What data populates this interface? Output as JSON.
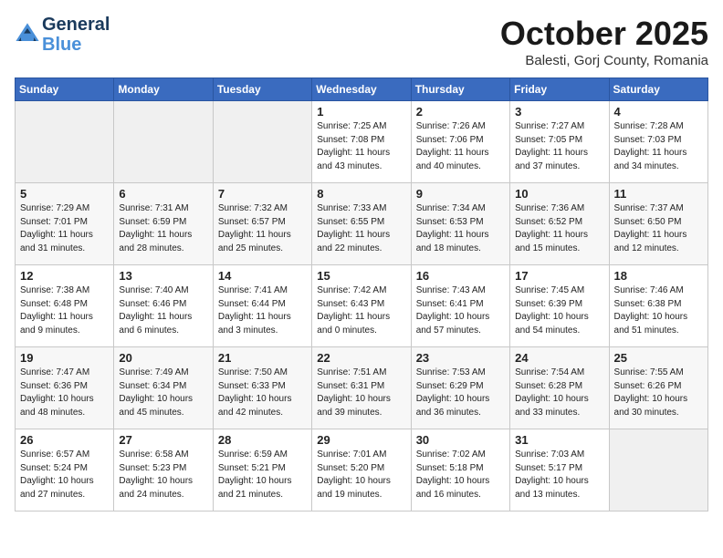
{
  "header": {
    "logo_line1": "General",
    "logo_line2": "Blue",
    "month": "October 2025",
    "location": "Balesti, Gorj County, Romania"
  },
  "weekdays": [
    "Sunday",
    "Monday",
    "Tuesday",
    "Wednesday",
    "Thursday",
    "Friday",
    "Saturday"
  ],
  "weeks": [
    [
      {
        "day": "",
        "info": "",
        "empty": true
      },
      {
        "day": "",
        "info": "",
        "empty": true
      },
      {
        "day": "",
        "info": "",
        "empty": true
      },
      {
        "day": "1",
        "info": "Sunrise: 7:25 AM\nSunset: 7:08 PM\nDaylight: 11 hours\nand 43 minutes."
      },
      {
        "day": "2",
        "info": "Sunrise: 7:26 AM\nSunset: 7:06 PM\nDaylight: 11 hours\nand 40 minutes."
      },
      {
        "day": "3",
        "info": "Sunrise: 7:27 AM\nSunset: 7:05 PM\nDaylight: 11 hours\nand 37 minutes."
      },
      {
        "day": "4",
        "info": "Sunrise: 7:28 AM\nSunset: 7:03 PM\nDaylight: 11 hours\nand 34 minutes."
      }
    ],
    [
      {
        "day": "5",
        "info": "Sunrise: 7:29 AM\nSunset: 7:01 PM\nDaylight: 11 hours\nand 31 minutes."
      },
      {
        "day": "6",
        "info": "Sunrise: 7:31 AM\nSunset: 6:59 PM\nDaylight: 11 hours\nand 28 minutes."
      },
      {
        "day": "7",
        "info": "Sunrise: 7:32 AM\nSunset: 6:57 PM\nDaylight: 11 hours\nand 25 minutes."
      },
      {
        "day": "8",
        "info": "Sunrise: 7:33 AM\nSunset: 6:55 PM\nDaylight: 11 hours\nand 22 minutes."
      },
      {
        "day": "9",
        "info": "Sunrise: 7:34 AM\nSunset: 6:53 PM\nDaylight: 11 hours\nand 18 minutes."
      },
      {
        "day": "10",
        "info": "Sunrise: 7:36 AM\nSunset: 6:52 PM\nDaylight: 11 hours\nand 15 minutes."
      },
      {
        "day": "11",
        "info": "Sunrise: 7:37 AM\nSunset: 6:50 PM\nDaylight: 11 hours\nand 12 minutes."
      }
    ],
    [
      {
        "day": "12",
        "info": "Sunrise: 7:38 AM\nSunset: 6:48 PM\nDaylight: 11 hours\nand 9 minutes."
      },
      {
        "day": "13",
        "info": "Sunrise: 7:40 AM\nSunset: 6:46 PM\nDaylight: 11 hours\nand 6 minutes."
      },
      {
        "day": "14",
        "info": "Sunrise: 7:41 AM\nSunset: 6:44 PM\nDaylight: 11 hours\nand 3 minutes."
      },
      {
        "day": "15",
        "info": "Sunrise: 7:42 AM\nSunset: 6:43 PM\nDaylight: 11 hours\nand 0 minutes."
      },
      {
        "day": "16",
        "info": "Sunrise: 7:43 AM\nSunset: 6:41 PM\nDaylight: 10 hours\nand 57 minutes."
      },
      {
        "day": "17",
        "info": "Sunrise: 7:45 AM\nSunset: 6:39 PM\nDaylight: 10 hours\nand 54 minutes."
      },
      {
        "day": "18",
        "info": "Sunrise: 7:46 AM\nSunset: 6:38 PM\nDaylight: 10 hours\nand 51 minutes."
      }
    ],
    [
      {
        "day": "19",
        "info": "Sunrise: 7:47 AM\nSunset: 6:36 PM\nDaylight: 10 hours\nand 48 minutes."
      },
      {
        "day": "20",
        "info": "Sunrise: 7:49 AM\nSunset: 6:34 PM\nDaylight: 10 hours\nand 45 minutes."
      },
      {
        "day": "21",
        "info": "Sunrise: 7:50 AM\nSunset: 6:33 PM\nDaylight: 10 hours\nand 42 minutes."
      },
      {
        "day": "22",
        "info": "Sunrise: 7:51 AM\nSunset: 6:31 PM\nDaylight: 10 hours\nand 39 minutes."
      },
      {
        "day": "23",
        "info": "Sunrise: 7:53 AM\nSunset: 6:29 PM\nDaylight: 10 hours\nand 36 minutes."
      },
      {
        "day": "24",
        "info": "Sunrise: 7:54 AM\nSunset: 6:28 PM\nDaylight: 10 hours\nand 33 minutes."
      },
      {
        "day": "25",
        "info": "Sunrise: 7:55 AM\nSunset: 6:26 PM\nDaylight: 10 hours\nand 30 minutes."
      }
    ],
    [
      {
        "day": "26",
        "info": "Sunrise: 6:57 AM\nSunset: 5:24 PM\nDaylight: 10 hours\nand 27 minutes."
      },
      {
        "day": "27",
        "info": "Sunrise: 6:58 AM\nSunset: 5:23 PM\nDaylight: 10 hours\nand 24 minutes."
      },
      {
        "day": "28",
        "info": "Sunrise: 6:59 AM\nSunset: 5:21 PM\nDaylight: 10 hours\nand 21 minutes."
      },
      {
        "day": "29",
        "info": "Sunrise: 7:01 AM\nSunset: 5:20 PM\nDaylight: 10 hours\nand 19 minutes."
      },
      {
        "day": "30",
        "info": "Sunrise: 7:02 AM\nSunset: 5:18 PM\nDaylight: 10 hours\nand 16 minutes."
      },
      {
        "day": "31",
        "info": "Sunrise: 7:03 AM\nSunset: 5:17 PM\nDaylight: 10 hours\nand 13 minutes."
      },
      {
        "day": "",
        "info": "",
        "empty": true
      }
    ]
  ]
}
